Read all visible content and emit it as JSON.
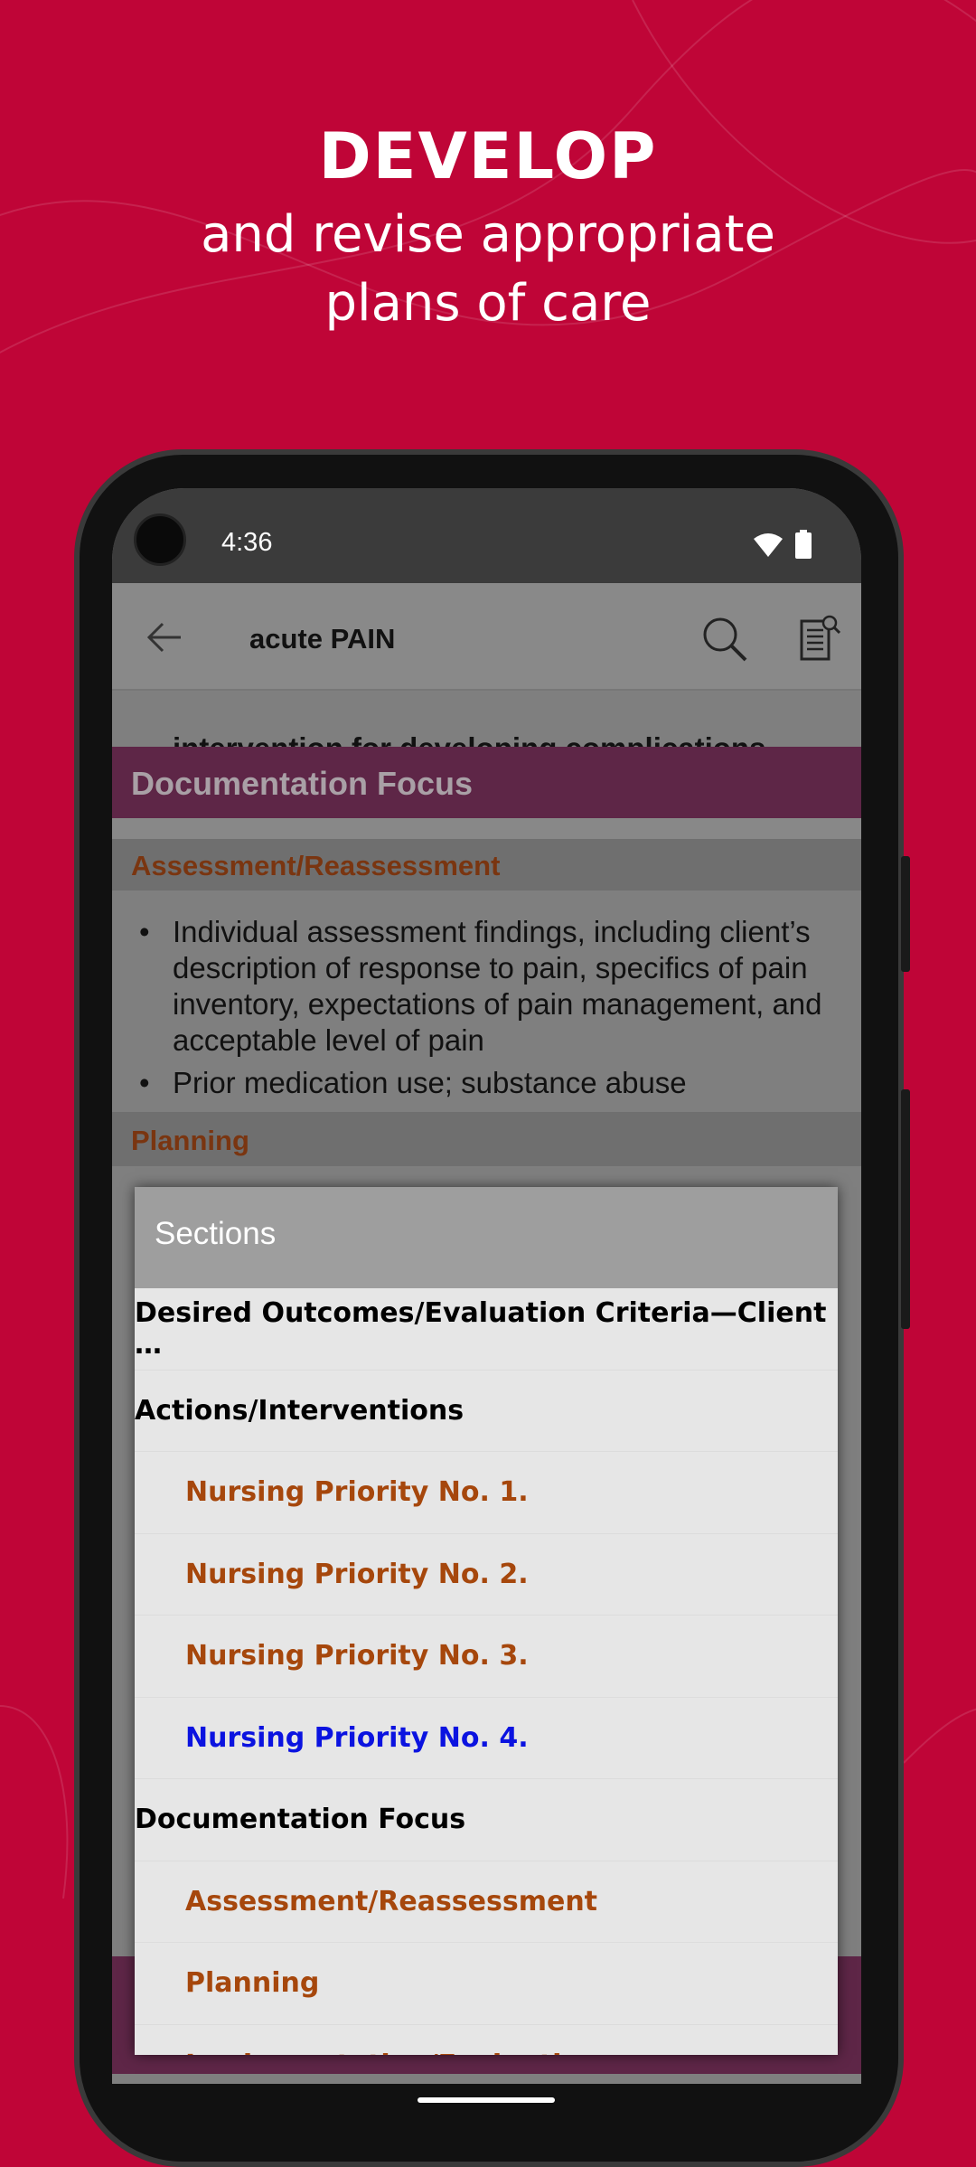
{
  "promo": {
    "headline": "DEVELOP",
    "subline1": "and revise appropriate",
    "subline2": "plans of care"
  },
  "colors": {
    "background": "#bf0537",
    "section_header": "#bc528f",
    "sub_item": "#a6470c",
    "active_item": "#0b13e0",
    "doc_header": "#5e2647"
  },
  "status_bar": {
    "time": "4:36",
    "icons": [
      "wifi-icon",
      "battery-icon"
    ]
  },
  "app_bar": {
    "title": "acute PAIN",
    "icons": [
      "back-arrow-icon",
      "search-icon",
      "document-search-icon"
    ]
  },
  "content": {
    "partial_line": "intervention for developing complications.",
    "section_title": "Documentation Focus",
    "subsection1": "Assessment/Reassessment",
    "bullets": [
      [
        "Individual assessment findings, including client’s",
        "description of response to pain, specifics of pain",
        "inventory, expectations of pain management, and",
        "acceptable level of pain"
      ],
      [
        "Prior medication use; substance abuse"
      ]
    ],
    "subsection2": "Planning"
  },
  "dialog": {
    "title": "Sections",
    "items": [
      {
        "label": "Desired Outcomes/Evaluation Criteria—Client …",
        "type": "section"
      },
      {
        "label": "Actions/Interventions",
        "type": "section"
      },
      {
        "label": "Nursing Priority No. 1.",
        "type": "sub"
      },
      {
        "label": "Nursing Priority No. 2.",
        "type": "sub"
      },
      {
        "label": "Nursing Priority No. 3.",
        "type": "sub"
      },
      {
        "label": "Nursing Priority No. 4.",
        "type": "sub",
        "active": true
      },
      {
        "label": "Documentation Focus",
        "type": "section"
      },
      {
        "label": "Assessment/Reassessment",
        "type": "sub"
      },
      {
        "label": "Planning",
        "type": "sub"
      },
      {
        "label": "Implementation/Evaluation",
        "type": "sub"
      }
    ]
  }
}
